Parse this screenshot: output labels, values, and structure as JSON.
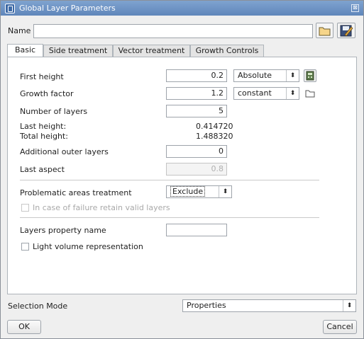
{
  "window": {
    "title": "Global Layer Parameters",
    "close_glyph": "⊠"
  },
  "name_row": {
    "label": "Name",
    "value": ""
  },
  "tabs": [
    {
      "label": "Basic",
      "active": true
    },
    {
      "label": "Side treatment",
      "active": false
    },
    {
      "label": "Vector treatment",
      "active": false
    },
    {
      "label": "Growth Controls",
      "active": false
    }
  ],
  "basic": {
    "first_height": {
      "label": "First height",
      "value": "0.2",
      "mode": "Absolute"
    },
    "growth_factor": {
      "label": "Growth factor",
      "value": "1.2",
      "mode": "constant"
    },
    "number_of_layers": {
      "label": "Number of layers",
      "value": "5"
    },
    "last_height": {
      "label": "Last height:",
      "value": "0.414720"
    },
    "total_height": {
      "label": "Total height:",
      "value": "1.488320"
    },
    "additional_outer_layers": {
      "label": "Additional outer layers",
      "value": "0"
    },
    "last_aspect": {
      "label": "Last aspect",
      "value": "0.8"
    },
    "problematic_areas": {
      "label": "Problematic areas treatment",
      "value": "Exclude"
    },
    "retain_valid_layers": {
      "label": "In case of failure retain valid layers",
      "checked": false,
      "enabled": false
    },
    "layers_property_name": {
      "label": "Layers property name",
      "value": ""
    },
    "light_volume": {
      "label": "Light volume representation",
      "checked": false
    }
  },
  "selection_mode": {
    "label": "Selection Mode",
    "value": "Properties"
  },
  "buttons": {
    "ok": "OK",
    "cancel": "Cancel"
  },
  "arrow_glyph": "⬍",
  "colors": {
    "titlebar": "#6b90c4",
    "panel": "#ffffff",
    "window": "#efefef"
  }
}
